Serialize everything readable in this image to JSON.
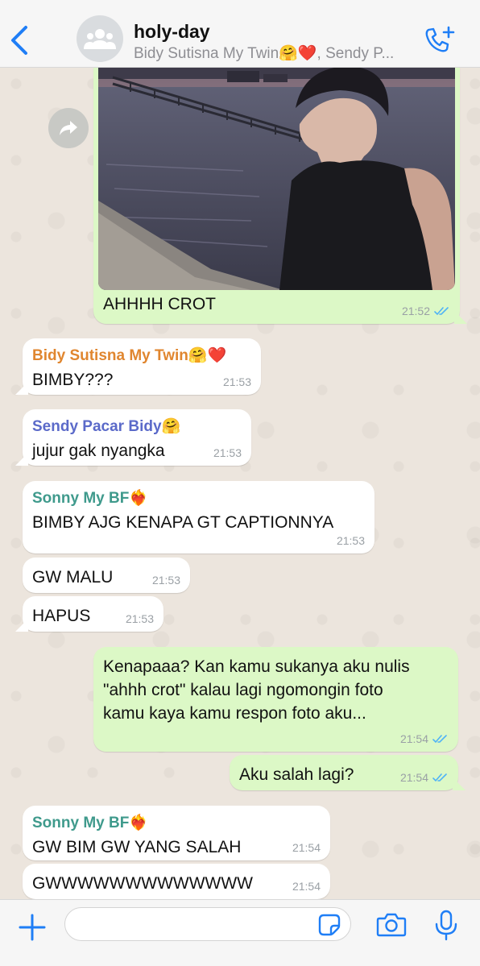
{
  "header": {
    "title": "holy-day",
    "subtitle": "Bidy Sutisna My Twin🤗❤️, Sendy P...",
    "back_icon": "chevron-left-icon",
    "avatar_icon": "group-avatar-icon",
    "call_icon": "add-call-icon"
  },
  "colors": {
    "accent": "#1f7ef6",
    "outgoing_bubble": "#dcf8c6",
    "incoming_bubble": "#ffffff",
    "read_ticks": "#4fb3f6"
  },
  "messages": [
    {
      "direction": "out",
      "type": "photo",
      "text": "AHHHH CROT",
      "time": "21:52",
      "read": true
    },
    {
      "direction": "in",
      "sender": "Bidy Sutisna My Twin🤗❤️",
      "sender_color": "#e0862f",
      "text": "BIMBY???",
      "time": "21:53"
    },
    {
      "direction": "in",
      "sender": "Sendy Pacar Bidy🤗",
      "sender_color": "#5b6ac9",
      "text": "jujur gak nyangka",
      "time": "21:53"
    },
    {
      "direction": "in",
      "sender": "Sonny My BF❤️‍🔥",
      "sender_color": "#3f9a8c",
      "text": "BIMBY AJG KENAPA GT CAPTIONNYA",
      "time": "21:53"
    },
    {
      "direction": "in",
      "text": "GW MALU",
      "time": "21:53"
    },
    {
      "direction": "in",
      "text": "HAPUS",
      "time": "21:53"
    },
    {
      "direction": "out",
      "text_lines": [
        "Kenapaaa? Kan kamu sukanya aku nulis",
        "\"ahhh crot\" kalau lagi ngomongin foto",
        "kamu kaya kamu respon foto aku..."
      ],
      "time": "21:54",
      "read": true
    },
    {
      "direction": "out",
      "text": "Aku salah lagi?",
      "time": "21:54",
      "read": true
    },
    {
      "direction": "in",
      "sender": "Sonny My BF❤️‍🔥",
      "sender_color": "#3f9a8c",
      "text": "GW BIM GW YANG SALAH",
      "time": "21:54"
    },
    {
      "direction": "in",
      "text": "GWWWWWWWWWWWWW",
      "time": "21:54"
    }
  ],
  "input": {
    "placeholder": "",
    "plus_icon": "plus-icon",
    "sticker_icon": "sticker-icon",
    "camera_icon": "camera-icon",
    "mic_icon": "microphone-icon"
  }
}
